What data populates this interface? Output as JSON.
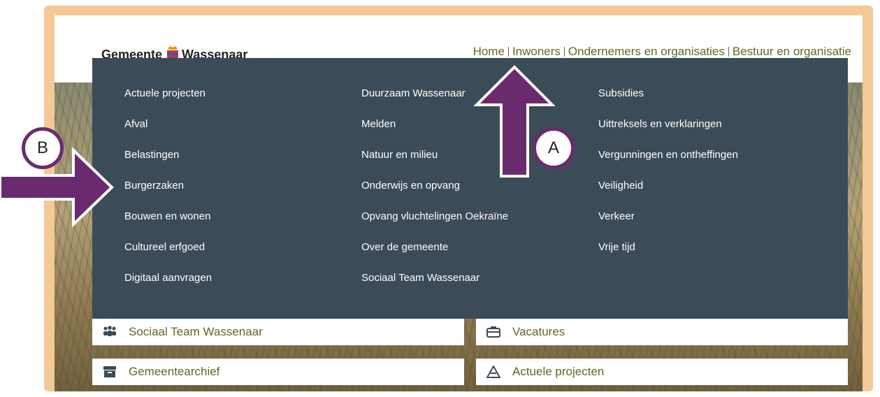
{
  "header": {
    "logo_text_left": "Gemeente",
    "logo_text_right": "Wassenaar",
    "nav": [
      {
        "label": "Home"
      },
      {
        "label": "Inwoners",
        "active": true
      },
      {
        "label": "Ondernemers en organisaties"
      },
      {
        "label": "Bestuur en organisatie"
      }
    ]
  },
  "menu": {
    "col1": [
      "Actuele projecten",
      "Afval",
      "Belastingen",
      "Burgerzaken",
      "Bouwen en wonen",
      "Cultureel erfgoed",
      "Digitaal aanvragen"
    ],
    "col2": [
      "Duurzaam Wassenaar",
      "Melden",
      "Natuur en milieu",
      "Onderwijs en opvang",
      "Opvang vluchtelingen Oekraïne",
      "Over de gemeente",
      "Sociaal Team Wassenaar"
    ],
    "col3": [
      "Subsidies",
      "Uittreksels en verklaringen",
      "Vergunningen en ontheffingen",
      "Veiligheid",
      "Verkeer",
      "Vrije tijd"
    ]
  },
  "tiles": {
    "sociaal_team": "Sociaal Team Wassenaar",
    "vacatures": "Vacatures",
    "gemeentearchief": "Gemeentearchief",
    "actuele_projecten": "Actuele projecten"
  },
  "annotations": {
    "a_label": "A",
    "b_label": "B"
  },
  "colors": {
    "frame": "#f3c995",
    "menu_bg": "#3c4b58",
    "nav_text": "#5d6a20",
    "annotation": "#6a2b6e"
  }
}
